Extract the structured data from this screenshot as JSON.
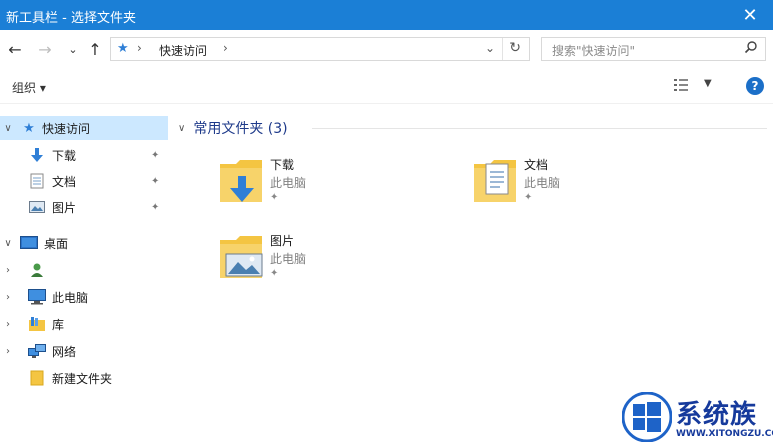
{
  "window": {
    "title": "新工具栏 - 选择文件夹",
    "close_glyph": "✕"
  },
  "address": {
    "back_glyph": "←",
    "forward_glyph": "→",
    "recent_glyph": "⌄",
    "up_glyph": "↑",
    "crumb": "快速访问",
    "crumb_sep": "›",
    "dropdown_glyph": "⌄",
    "refresh_glyph": "↻"
  },
  "search": {
    "placeholder": "搜索\"快速访问\"",
    "icon_glyph": "⚲"
  },
  "toolbar": {
    "organize_label": "组织 ▾",
    "view_dropdown": "▼",
    "help_label": "?"
  },
  "nav": {
    "quick_access": "快速访问",
    "downloads": "下载",
    "documents": "文档",
    "pictures": "图片",
    "desktop": "桌面",
    "user": "",
    "this_pc": "此电脑",
    "library": "库",
    "network": "网络",
    "new_folder": "新建文件夹",
    "chev_open": "∨",
    "chev_closed": "›",
    "pin_glyph": "✦"
  },
  "content": {
    "group_title": "常用文件夹 (3)",
    "group_chev": "∨",
    "items": [
      {
        "name": "下载",
        "location": "此电脑"
      },
      {
        "name": "文档",
        "location": "此电脑"
      },
      {
        "name": "图片",
        "location": "此电脑"
      }
    ]
  },
  "watermark": {
    "text": "系统族",
    "url": "WWW.XITONGZU.COM"
  },
  "colors": {
    "accent": "#1b7fd6",
    "selection": "#cce8ff",
    "folder": "#f4c542",
    "watermark": "#163a9c"
  }
}
